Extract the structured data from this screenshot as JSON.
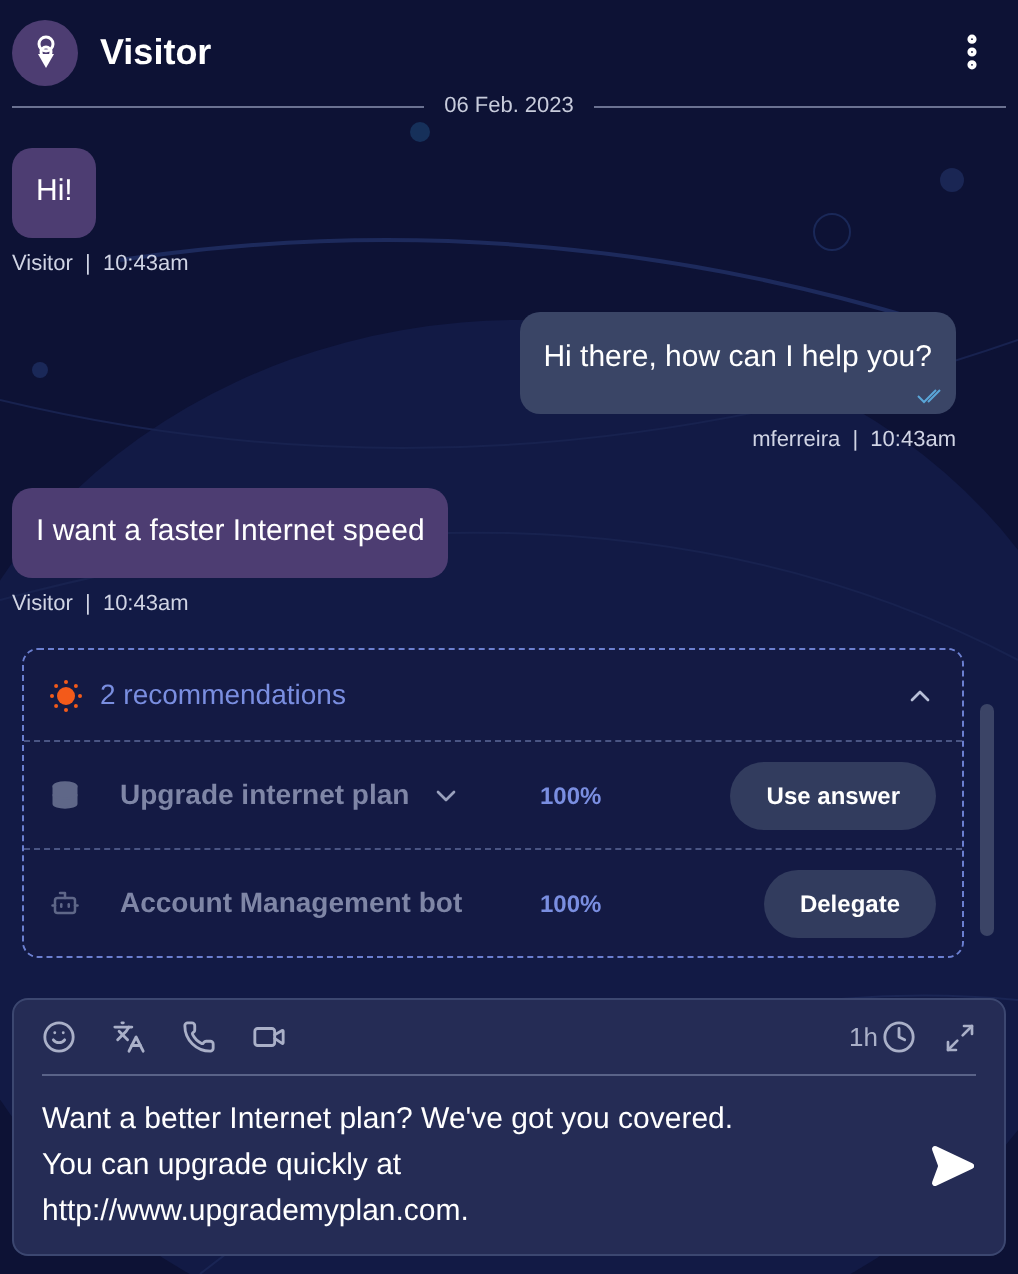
{
  "header": {
    "title": "Visitor"
  },
  "date_separator": "06 Feb. 2023",
  "messages": [
    {
      "kind": "visitor",
      "text": "Hi!",
      "meta": "Visitor  |  10:43am"
    },
    {
      "kind": "agent",
      "text": "Hi there, how can I help you?",
      "meta": "mferreira  |  10:43am",
      "read": true
    },
    {
      "kind": "visitor",
      "text": "I want a faster Internet speed",
      "meta": "Visitor  |  10:43am"
    }
  ],
  "recommendations": {
    "title": "2 recommendations",
    "expanded": true,
    "items": [
      {
        "kind": "database",
        "title": "Upgrade internet plan",
        "has_options": true,
        "score": "100%",
        "action": "Use answer"
      },
      {
        "kind": "bot",
        "title": "Account Management bot",
        "has_options": false,
        "score": "100%",
        "action": "Delegate"
      }
    ]
  },
  "composer": {
    "timer": "1h",
    "message_lines": [
      "Want a better Internet plan? We've got you covered.",
      "You can upgrade quickly at",
      "http://www.upgrademyplan.com."
    ]
  }
}
